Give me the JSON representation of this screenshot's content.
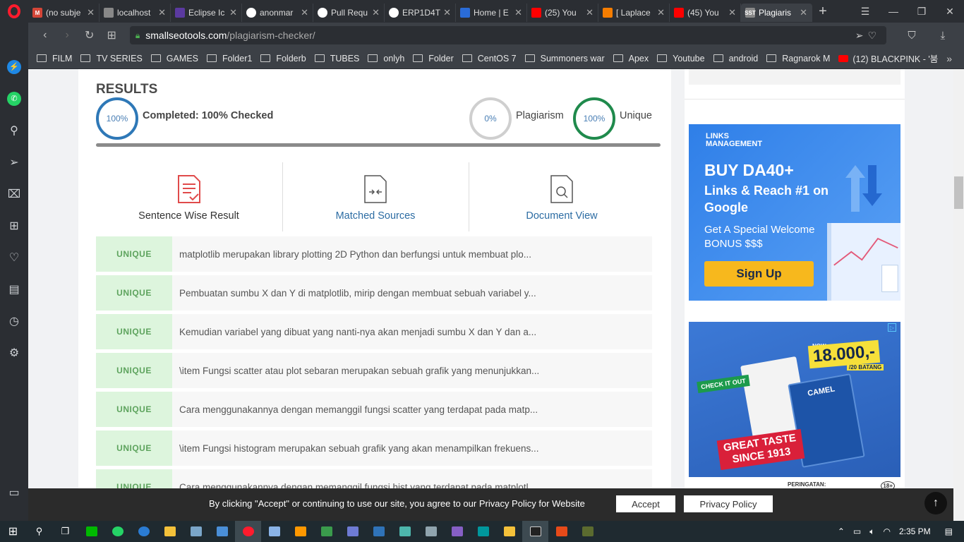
{
  "browser": {
    "tabs": [
      {
        "title": "(no subje",
        "fav_color": "#d44638",
        "fav_text": "M"
      },
      {
        "title": "localhost",
        "fav_color": "#888888",
        "fav_text": ""
      },
      {
        "title": "Eclipse Ic",
        "fav_color": "#5b3aa0",
        "fav_text": ""
      },
      {
        "title": "anonmar",
        "fav_color": "#ffffff",
        "fav_text": ""
      },
      {
        "title": "Pull Requ",
        "fav_color": "#ffffff",
        "fav_text": ""
      },
      {
        "title": "ERP1D4T",
        "fav_color": "#ffffff",
        "fav_text": ""
      },
      {
        "title": "Home | E",
        "fav_color": "#2a6cd8",
        "fav_text": ""
      },
      {
        "title": "(25) You",
        "fav_color": "#ff0000",
        "fav_text": ""
      },
      {
        "title": "[ Laplace",
        "fav_color": "#f57d00",
        "fav_text": ""
      },
      {
        "title": "(45) You",
        "fav_color": "#ff0000",
        "fav_text": ""
      },
      {
        "title": "Plagiaris",
        "fav_color": "#888888",
        "fav_text": "SST"
      }
    ],
    "url_domain": "smallseotools.com",
    "url_path": "/plagiarism-checker/",
    "bookmarks": [
      "FILM",
      "TV SERIES",
      "GAMES",
      "Folder1",
      "Folderb",
      "TUBES",
      "onlyh",
      "Folder",
      "CentOS 7",
      "Summoners war",
      "Apex",
      "Youtube",
      "android",
      "Ragnarok M"
    ],
    "bookmark_youtube": "(12) BLACKPINK - '붐",
    "more_glyph": "»"
  },
  "results": {
    "title": "RESULTS",
    "completed_pct": "100%",
    "completed_label": "Completed: 100% Checked",
    "plagiarism_pct": "0%",
    "plagiarism_label": "Plagiarism",
    "unique_pct": "100%",
    "unique_label": "Unique",
    "progress": 1.0
  },
  "views": [
    {
      "label": "Sentence Wise Result"
    },
    {
      "label": "Matched Sources"
    },
    {
      "label": "Document View"
    }
  ],
  "sentences": [
    {
      "status": "UNIQUE",
      "text": "matplotlib merupakan library plotting 2D Python dan berfungsi untuk membuat plo..."
    },
    {
      "status": "UNIQUE",
      "text": "Pembuatan sumbu X dan Y di matplotlib, mirip dengan membuat sebuah variabel y..."
    },
    {
      "status": "UNIQUE",
      "text": "Kemudian variabel yang dibuat yang nanti-nya akan menjadi sumbu X dan Y dan a..."
    },
    {
      "status": "UNIQUE",
      "text": "\\item Fungsi scatter atau plot sebaran merupakan sebuah grafik yang menunjukkan..."
    },
    {
      "status": "UNIQUE",
      "text": "Cara menggunakannya dengan memanggil fungsi scatter yang terdapat pada matp..."
    },
    {
      "status": "UNIQUE",
      "text": "\\item Fungsi histogram merupakan sebuah grafik yang akan menampilkan frekuens..."
    },
    {
      "status": "UNIQUE",
      "text": "Cara menggunakannya dengan memanggil fungsi hist yang terdapat pada matplotl..."
    }
  ],
  "ads": {
    "ad1_brand_line1": "LINKS",
    "ad1_brand_line2": "MANAGEMENT",
    "ad1_headline": "BUY DA40+",
    "ad1_sub_headline": "Links & Reach #1 on Google",
    "ad1_text": "Get A Special Welcome BONUS $$$",
    "ad1_button": "Sign Up",
    "ad2_price_top": "NOW",
    "ad2_price": "18.000,-",
    "ad2_price_unit": "/20 BATANG",
    "ad2_check": "CHECK IT OUT",
    "ad2_brand": "CAMEL",
    "ad2_taste_line1": "GREAT TASTE",
    "ad2_taste_line2": "SINCE 1913",
    "ad2_warning": "PERINGATAN:",
    "ad2_age": "18+"
  },
  "cookie": {
    "text": "By clicking \"Accept\" or continuing to use our site, you agree to our Privacy Policy for Website",
    "accept": "Accept",
    "privacy": "Privacy Policy"
  },
  "taskbar": {
    "time": "2:35 PM"
  }
}
